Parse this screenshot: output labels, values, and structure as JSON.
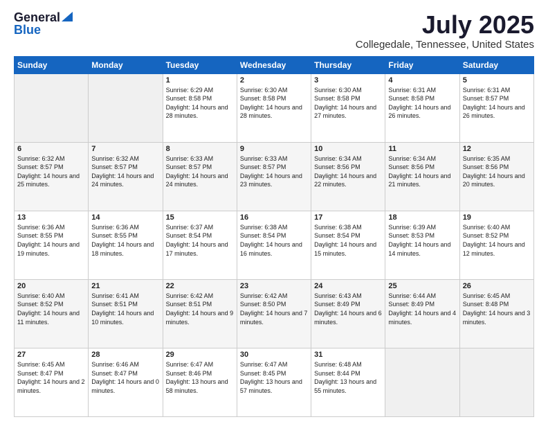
{
  "logo": {
    "general": "General",
    "blue": "Blue"
  },
  "title": "July 2025",
  "subtitle": "Collegedale, Tennessee, United States",
  "days_of_week": [
    "Sunday",
    "Monday",
    "Tuesday",
    "Wednesday",
    "Thursday",
    "Friday",
    "Saturday"
  ],
  "weeks": [
    [
      {
        "day": "",
        "info": ""
      },
      {
        "day": "",
        "info": ""
      },
      {
        "day": "1",
        "info": "Sunrise: 6:29 AM\nSunset: 8:58 PM\nDaylight: 14 hours and 28 minutes."
      },
      {
        "day": "2",
        "info": "Sunrise: 6:30 AM\nSunset: 8:58 PM\nDaylight: 14 hours and 28 minutes."
      },
      {
        "day": "3",
        "info": "Sunrise: 6:30 AM\nSunset: 8:58 PM\nDaylight: 14 hours and 27 minutes."
      },
      {
        "day": "4",
        "info": "Sunrise: 6:31 AM\nSunset: 8:58 PM\nDaylight: 14 hours and 26 minutes."
      },
      {
        "day": "5",
        "info": "Sunrise: 6:31 AM\nSunset: 8:57 PM\nDaylight: 14 hours and 26 minutes."
      }
    ],
    [
      {
        "day": "6",
        "info": "Sunrise: 6:32 AM\nSunset: 8:57 PM\nDaylight: 14 hours and 25 minutes."
      },
      {
        "day": "7",
        "info": "Sunrise: 6:32 AM\nSunset: 8:57 PM\nDaylight: 14 hours and 24 minutes."
      },
      {
        "day": "8",
        "info": "Sunrise: 6:33 AM\nSunset: 8:57 PM\nDaylight: 14 hours and 24 minutes."
      },
      {
        "day": "9",
        "info": "Sunrise: 6:33 AM\nSunset: 8:57 PM\nDaylight: 14 hours and 23 minutes."
      },
      {
        "day": "10",
        "info": "Sunrise: 6:34 AM\nSunset: 8:56 PM\nDaylight: 14 hours and 22 minutes."
      },
      {
        "day": "11",
        "info": "Sunrise: 6:34 AM\nSunset: 8:56 PM\nDaylight: 14 hours and 21 minutes."
      },
      {
        "day": "12",
        "info": "Sunrise: 6:35 AM\nSunset: 8:56 PM\nDaylight: 14 hours and 20 minutes."
      }
    ],
    [
      {
        "day": "13",
        "info": "Sunrise: 6:36 AM\nSunset: 8:55 PM\nDaylight: 14 hours and 19 minutes."
      },
      {
        "day": "14",
        "info": "Sunrise: 6:36 AM\nSunset: 8:55 PM\nDaylight: 14 hours and 18 minutes."
      },
      {
        "day": "15",
        "info": "Sunrise: 6:37 AM\nSunset: 8:54 PM\nDaylight: 14 hours and 17 minutes."
      },
      {
        "day": "16",
        "info": "Sunrise: 6:38 AM\nSunset: 8:54 PM\nDaylight: 14 hours and 16 minutes."
      },
      {
        "day": "17",
        "info": "Sunrise: 6:38 AM\nSunset: 8:54 PM\nDaylight: 14 hours and 15 minutes."
      },
      {
        "day": "18",
        "info": "Sunrise: 6:39 AM\nSunset: 8:53 PM\nDaylight: 14 hours and 14 minutes."
      },
      {
        "day": "19",
        "info": "Sunrise: 6:40 AM\nSunset: 8:52 PM\nDaylight: 14 hours and 12 minutes."
      }
    ],
    [
      {
        "day": "20",
        "info": "Sunrise: 6:40 AM\nSunset: 8:52 PM\nDaylight: 14 hours and 11 minutes."
      },
      {
        "day": "21",
        "info": "Sunrise: 6:41 AM\nSunset: 8:51 PM\nDaylight: 14 hours and 10 minutes."
      },
      {
        "day": "22",
        "info": "Sunrise: 6:42 AM\nSunset: 8:51 PM\nDaylight: 14 hours and 9 minutes."
      },
      {
        "day": "23",
        "info": "Sunrise: 6:42 AM\nSunset: 8:50 PM\nDaylight: 14 hours and 7 minutes."
      },
      {
        "day": "24",
        "info": "Sunrise: 6:43 AM\nSunset: 8:49 PM\nDaylight: 14 hours and 6 minutes."
      },
      {
        "day": "25",
        "info": "Sunrise: 6:44 AM\nSunset: 8:49 PM\nDaylight: 14 hours and 4 minutes."
      },
      {
        "day": "26",
        "info": "Sunrise: 6:45 AM\nSunset: 8:48 PM\nDaylight: 14 hours and 3 minutes."
      }
    ],
    [
      {
        "day": "27",
        "info": "Sunrise: 6:45 AM\nSunset: 8:47 PM\nDaylight: 14 hours and 2 minutes."
      },
      {
        "day": "28",
        "info": "Sunrise: 6:46 AM\nSunset: 8:47 PM\nDaylight: 14 hours and 0 minutes."
      },
      {
        "day": "29",
        "info": "Sunrise: 6:47 AM\nSunset: 8:46 PM\nDaylight: 13 hours and 58 minutes."
      },
      {
        "day": "30",
        "info": "Sunrise: 6:47 AM\nSunset: 8:45 PM\nDaylight: 13 hours and 57 minutes."
      },
      {
        "day": "31",
        "info": "Sunrise: 6:48 AM\nSunset: 8:44 PM\nDaylight: 13 hours and 55 minutes."
      },
      {
        "day": "",
        "info": ""
      },
      {
        "day": "",
        "info": ""
      }
    ]
  ]
}
